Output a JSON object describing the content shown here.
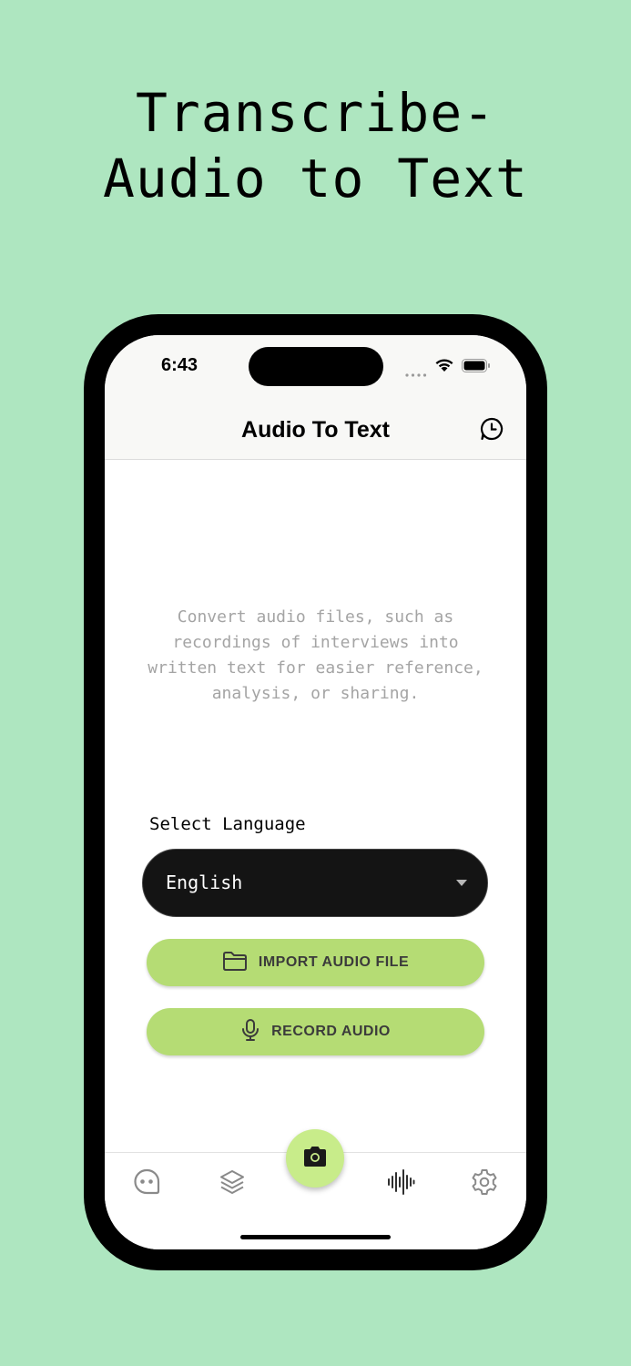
{
  "promo": {
    "title": "Transcribe-\nAudio to Text"
  },
  "status_bar": {
    "time": "6:43"
  },
  "nav": {
    "title": "Audio To Text",
    "history_icon": "history-clock-icon"
  },
  "main": {
    "description": "Convert audio files, such as recordings of interviews into written text for easier reference, analysis, or sharing.",
    "language_label": "Select Language",
    "language_selected": "English",
    "import_button": "IMPORT AUDIO FILE",
    "record_button": "RECORD AUDIO"
  },
  "tab_bar": {
    "items": [
      "chat-icon",
      "layers-icon",
      "camera-icon",
      "waveform-icon",
      "settings-gear-icon"
    ]
  },
  "colors": {
    "background": "#aee6c0",
    "accent_green": "#b5dc74",
    "fab_green": "#c8ec8a",
    "select_dark": "#141414"
  }
}
